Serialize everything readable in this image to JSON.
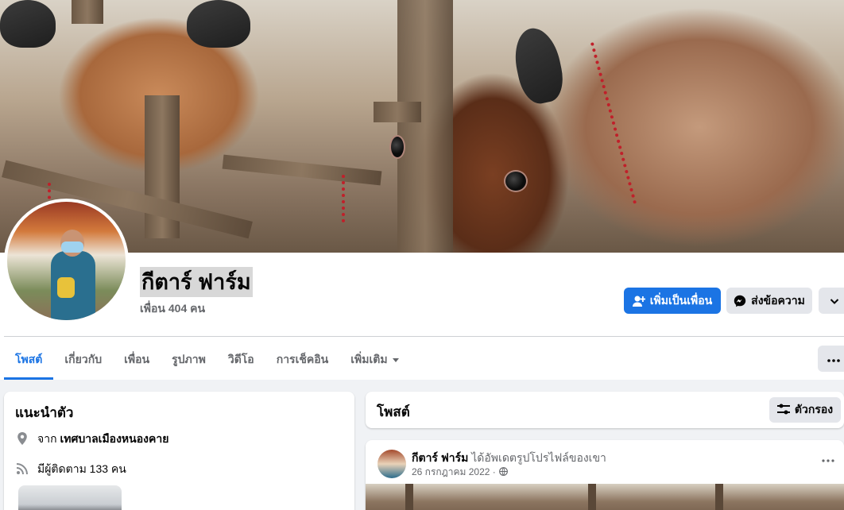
{
  "profile": {
    "name": "กีตาร์ ฟาร์ม",
    "friends_count": "เพื่อน 404 คน"
  },
  "actions": {
    "add_friend": "เพิ่มเป็นเพื่อน",
    "message": "ส่งข้อความ"
  },
  "tabs": [
    {
      "label": "โพสต์",
      "active": true
    },
    {
      "label": "เกี่ยวกับ"
    },
    {
      "label": "เพื่อน"
    },
    {
      "label": "รูปภาพ"
    },
    {
      "label": "วิดีโอ"
    },
    {
      "label": "การเช็คอิน"
    },
    {
      "label": "เพิ่มเติม"
    }
  ],
  "intro": {
    "title": "แนะนำตัว",
    "from_prefix": "จาก",
    "from_place": "เทศบาลเมืองหนองคาย",
    "followers": "มีผู้ติดตาม 133 คน"
  },
  "posts": {
    "title": "โพสต์",
    "filter_label": "ตัวกรอง"
  },
  "post": {
    "author": "กีตาร์ ฟาร์ม",
    "action": "ได้อัพเดตรูปโปรไฟล์ของเขา",
    "date": "26 กรกฎาคม 2022 ·"
  },
  "colors": {
    "accent": "#1b74e4",
    "background": "#f0f2f5",
    "secondary_text": "#65676b"
  }
}
